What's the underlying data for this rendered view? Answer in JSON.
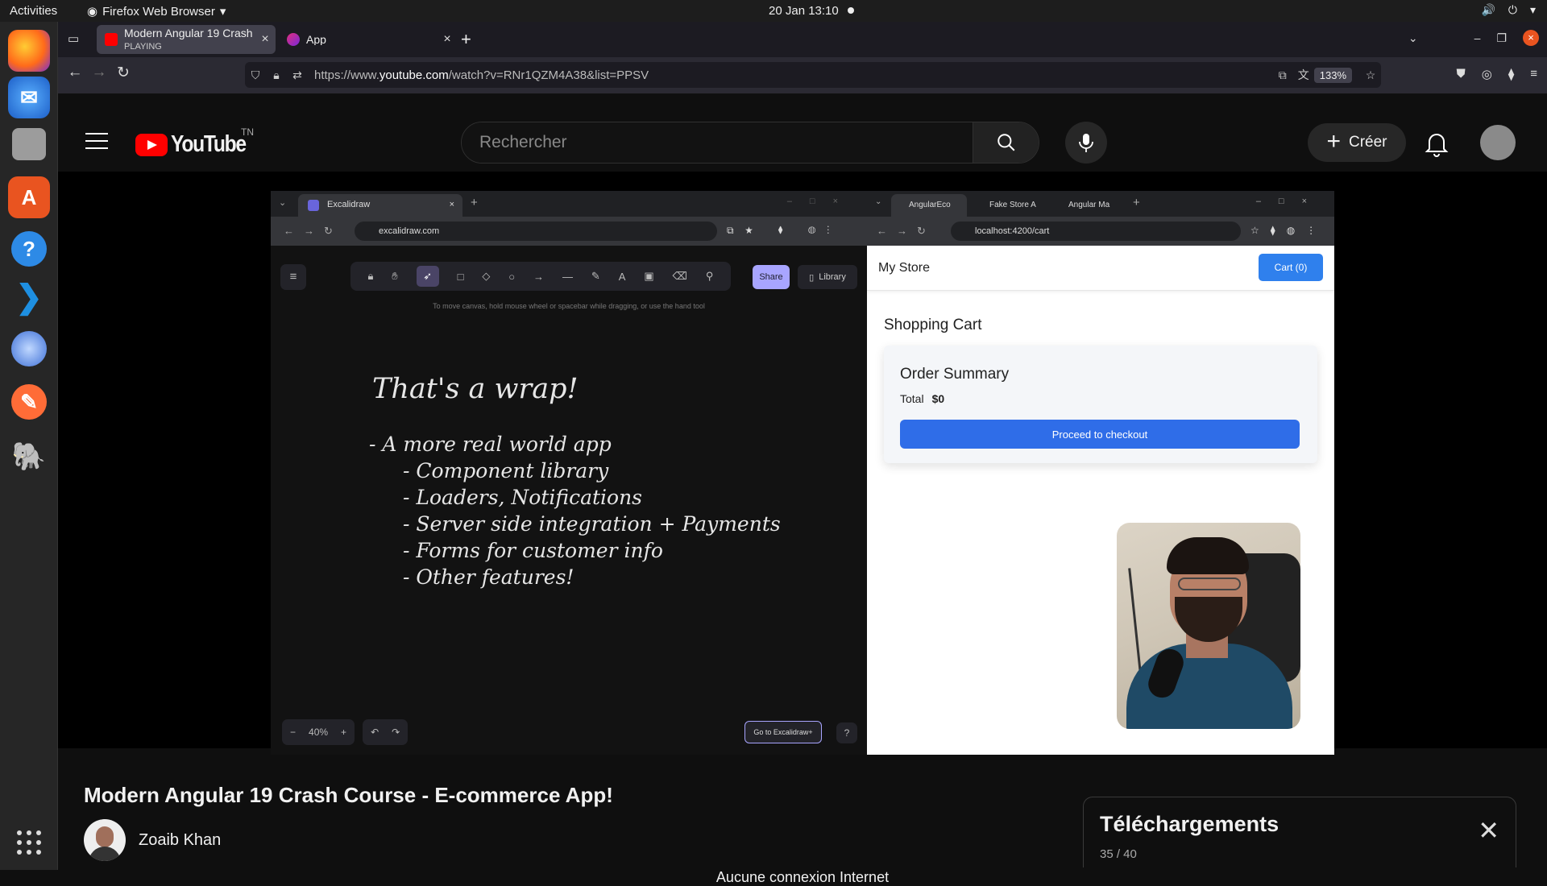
{
  "system": {
    "activities": "Activities",
    "app_name": "Firefox Web Browser",
    "clock": "20 Jan  13:10"
  },
  "browser": {
    "tabs": [
      {
        "title": "Modern Angular 19 Crash",
        "status": "PLAYING"
      },
      {
        "title": "App"
      }
    ],
    "url_prefix": "https://www.",
    "url_domain": "youtube.com",
    "url_path": "/watch?v=RNr1QZM4A38&list=PPSV",
    "zoom": "133%"
  },
  "youtube": {
    "logo_text": "YouTube",
    "country": "TN",
    "search_placeholder": "Rechercher",
    "create_label": "Créer",
    "video_title": "Modern Angular 19 Crash Course - E-commerce App!",
    "channel": "Zoaib Khan",
    "downloads_title": "Téléchargements",
    "downloads_count": "35 / 40",
    "offline_message": "Aucune connexion Internet"
  },
  "video_frame": {
    "left_tab": "Excalidraw",
    "left_url": "excalidraw.com",
    "share": "Share",
    "library": "Library",
    "hint": "To move canvas, hold mouse wheel or spacebar while dragging, or use the hand tool",
    "wrap_title": "That's a wrap!",
    "wrap_lines": [
      "- A more real world app",
      "- Component library",
      "- Loaders, Notifications",
      "- Server side integration + Payments",
      "- Forms for customer info",
      "- Other features!"
    ],
    "zoom": "40%",
    "goto": "Go to Excalidraw+",
    "right_tabs": [
      "AngularEco",
      "Fake Store A",
      "Angular Ma"
    ],
    "right_url": "localhost:4200/cart",
    "store_name": "My Store",
    "cart_button": "Cart (0)",
    "shopping_cart": "Shopping Cart",
    "order_summary": "Order Summary",
    "total_label": "Total",
    "total_value": "$0",
    "checkout": "Proceed to checkout"
  },
  "colors": {
    "youtube_red": "#ff0000",
    "ubuntu_orange": "#e95420",
    "cart_blue": "#2f80ed"
  }
}
